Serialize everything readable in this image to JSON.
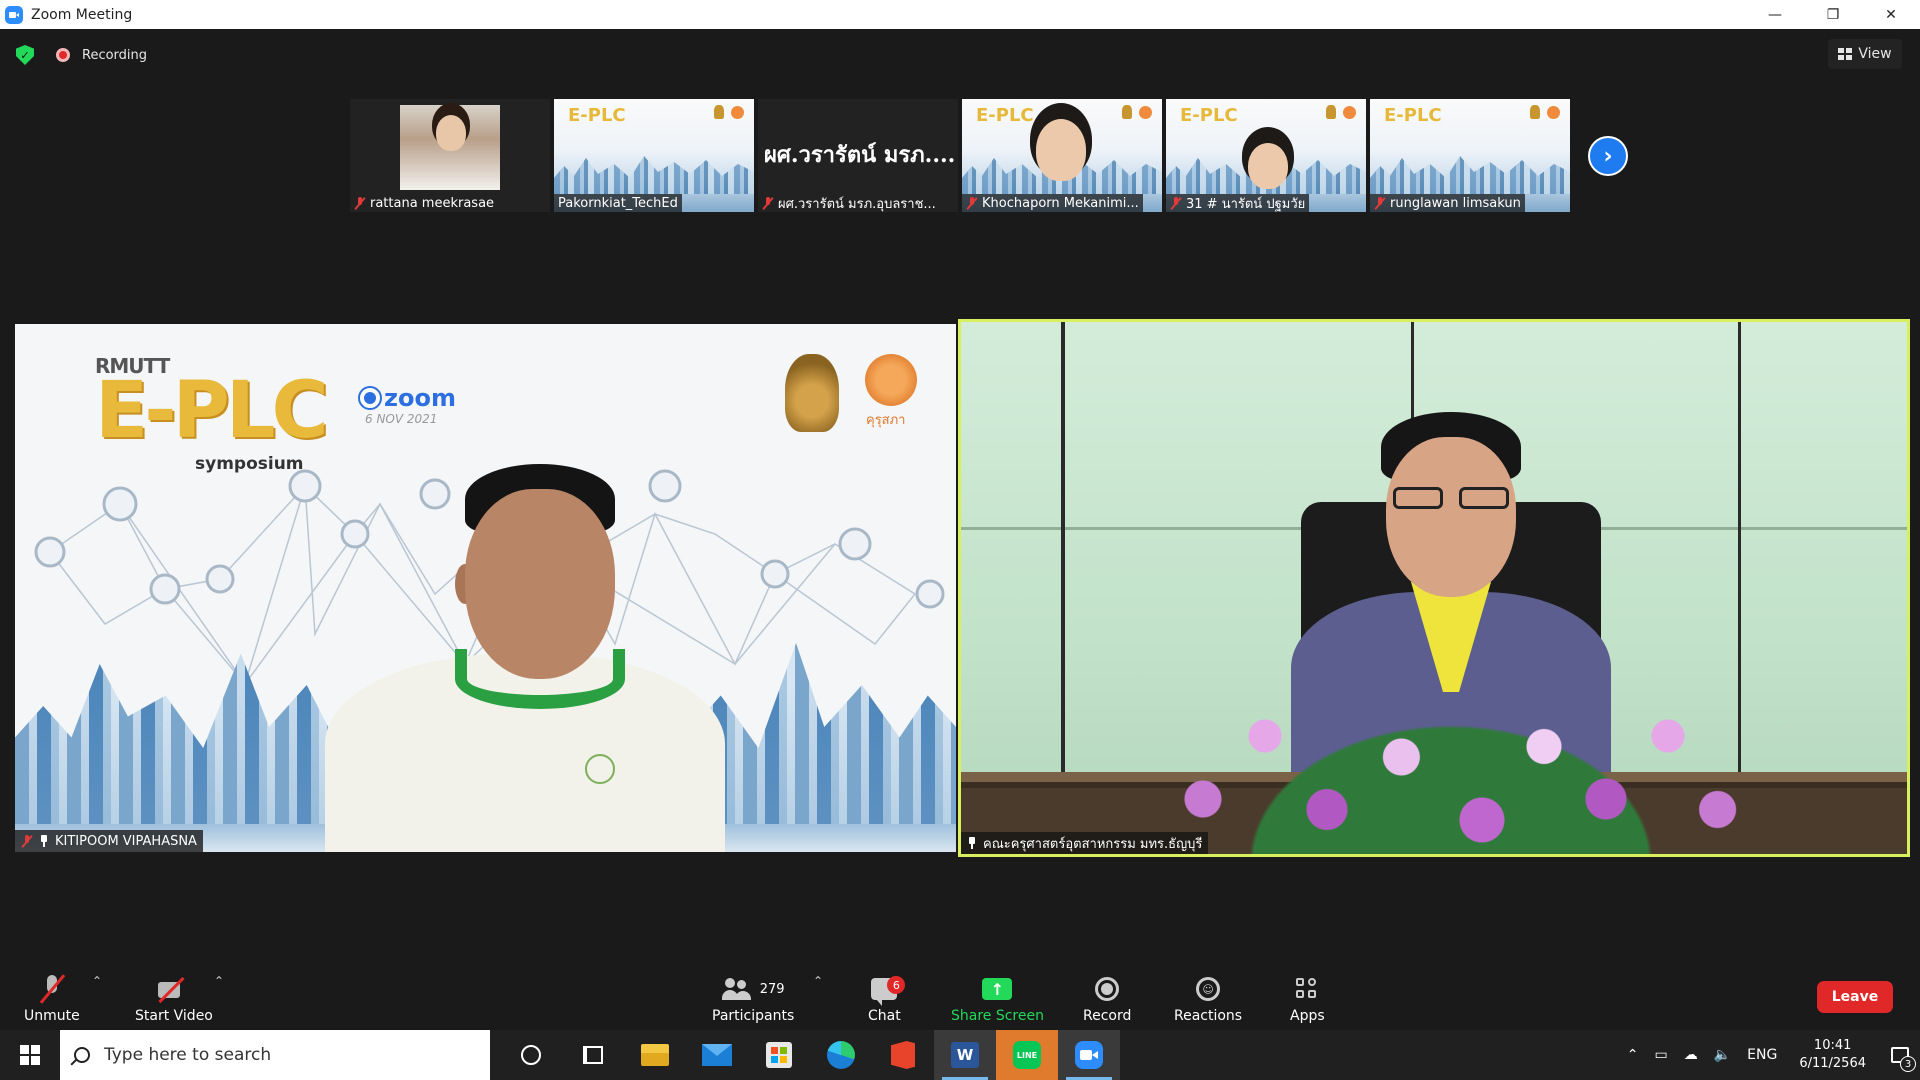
{
  "window": {
    "title": "Zoom Meeting"
  },
  "meeting": {
    "recording_label": "Recording",
    "view_label": "View"
  },
  "thumbnails": [
    {
      "name": "rattana meekrasae",
      "muted": true,
      "kind": "photo"
    },
    {
      "name": "Pakornkiat_TechEd",
      "muted": false,
      "kind": "plc"
    },
    {
      "name": "ผศ.วรารัตน์ มรภ.อุบลราช...",
      "muted": true,
      "kind": "text",
      "display_text": "ผศ.วรารัตน์ มรภ...."
    },
    {
      "name": "Khochaporn Mekanimi...",
      "muted": true,
      "kind": "plc-face"
    },
    {
      "name": "31 # นารัตน์ ปฐมวัย",
      "muted": true,
      "kind": "plc-face-sm"
    },
    {
      "name": "runglawan limsakun",
      "muted": true,
      "kind": "plc"
    }
  ],
  "main_left": {
    "logo_top": "RMUTT",
    "logo_main": "E-PLC",
    "logo_sub": "symposium",
    "zoom_text": "zoom",
    "zoom_date": "6 NOV 2021",
    "seal_text": "คุรุสภา",
    "name": "KITIPOOM VIPAHASNA"
  },
  "main_right": {
    "name": "คณะครุศาสตร์อุตสาหกรรม มทร.ธัญบุรี"
  },
  "toolbar": {
    "unmute": "Unmute",
    "start_video": "Start Video",
    "participants": "Participants",
    "participants_count": "279",
    "chat": "Chat",
    "chat_badge": "6",
    "share_screen": "Share Screen",
    "record": "Record",
    "reactions": "Reactions",
    "apps": "Apps",
    "leave": "Leave"
  },
  "taskbar": {
    "search_placeholder": "Type here to search",
    "lang": "ENG",
    "time": "10:41",
    "date": "6/11/2564",
    "notifications": "3"
  },
  "colors": {
    "accent": "#2d8cff",
    "share_green": "#23d959",
    "leave_red": "#e02828",
    "active_speaker": "#d8f060"
  }
}
